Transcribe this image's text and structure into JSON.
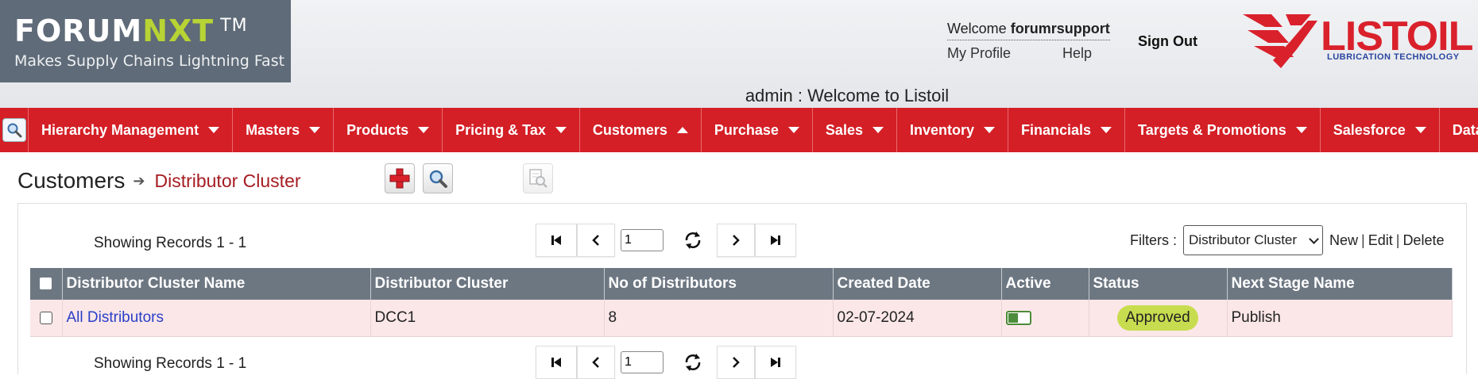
{
  "brand": {
    "name_a": "FORUM",
    "name_b": "NXT",
    "tm": "TM",
    "tagline": "Makes Supply Chains Lightning Fast"
  },
  "user": {
    "welcome_prefix": "Welcome",
    "username": "forumrsupport",
    "my_profile": "My Profile",
    "help": "Help",
    "sign_out": "Sign Out"
  },
  "client_logo": {
    "name": "LISTOIL",
    "tagline": "LUBRICATION TECHNOLOGY"
  },
  "admin_welcome": "admin : Welcome to Listoil",
  "nav": {
    "items": [
      {
        "label": "Hierarchy Management",
        "caret": "down"
      },
      {
        "label": "Masters",
        "caret": "down"
      },
      {
        "label": "Products",
        "caret": "down"
      },
      {
        "label": "Pricing & Tax",
        "caret": "down"
      },
      {
        "label": "Customers",
        "caret": "up"
      },
      {
        "label": "Purchase",
        "caret": "down"
      },
      {
        "label": "Sales",
        "caret": "down"
      },
      {
        "label": "Inventory",
        "caret": "down"
      },
      {
        "label": "Financials",
        "caret": "down"
      },
      {
        "label": "Targets & Promotions",
        "caret": "down"
      },
      {
        "label": "Salesforce",
        "caret": "down"
      },
      {
        "label": "Data Exch",
        "caret": "none"
      }
    ]
  },
  "page": {
    "title": "Customers",
    "subtitle": "Distributor Cluster"
  },
  "pager": {
    "showing_top": "Showing Records 1 - 1",
    "showing_bottom": "Showing Records 1 - 1",
    "page_value": "1"
  },
  "filters": {
    "label": "Filters :",
    "selected": "Distributor Cluster",
    "new": "New",
    "edit": "Edit",
    "delete": "Delete"
  },
  "table": {
    "headers": [
      "Distributor Cluster Name",
      "Distributor Cluster",
      "No of Distributors",
      "Created Date",
      "Active",
      "Status",
      "Next Stage Name"
    ],
    "rows": [
      {
        "name": "All Distributors",
        "cluster": "DCC1",
        "count": "8",
        "created": "02-07-2024",
        "active": true,
        "status": "Approved",
        "next_stage": "Publish"
      }
    ]
  },
  "colors": {
    "nav_red": "#d41f26",
    "brand_green": "#b7d334",
    "logo_red": "#d9212c",
    "status_badge": "#c8dc4f",
    "link_blue": "#2b3fc8"
  }
}
